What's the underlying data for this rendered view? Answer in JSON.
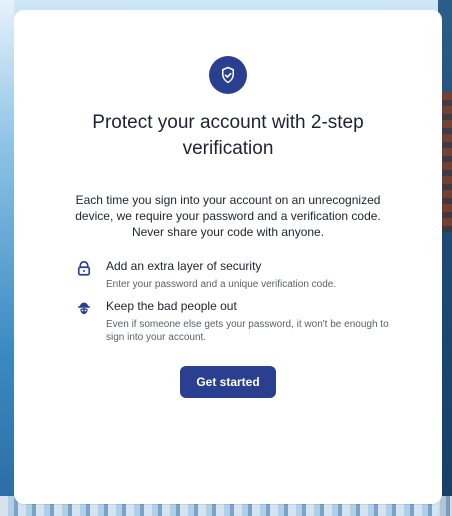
{
  "background": {
    "sky_color": "#2f8fd0"
  },
  "card": {
    "icon": "shield-check-icon",
    "title": "Protect your account with 2-step verification",
    "description": "Each time you sign into your account on an unrecognized device, we require your password and a verification code. Never share your code with anyone.",
    "benefits": [
      {
        "icon": "lock-icon",
        "heading": "Add an extra layer of security",
        "text": "Enter your password and a unique verification code."
      },
      {
        "icon": "spy-icon",
        "heading": "Keep the bad people out",
        "text": "Even if someone else gets your password, it won't be enough to sign into your account."
      }
    ],
    "cta_label": "Get started"
  },
  "colors": {
    "brand": "#2a3f8f",
    "text": "#1f2230",
    "muted_text": "#5b5f6b",
    "card_bg": "#ffffff"
  }
}
